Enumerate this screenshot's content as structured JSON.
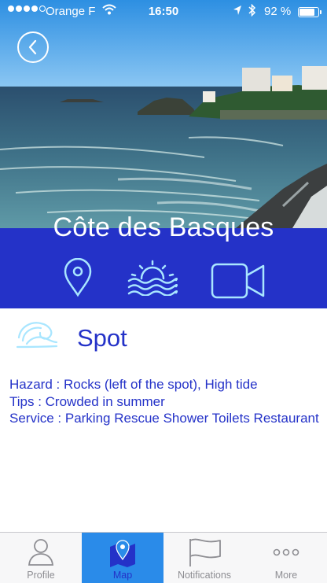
{
  "status_bar": {
    "carrier": "Orange F",
    "time": "16:50",
    "battery": "92 %",
    "battery_level": 0.92
  },
  "header": {
    "title": "Côte des Basques"
  },
  "actions": [
    {
      "icon": "location-pin-icon"
    },
    {
      "icon": "sunset-icon"
    },
    {
      "icon": "video-camera-icon"
    }
  ],
  "section": {
    "icon": "wave-icon",
    "title": "Spot"
  },
  "info": {
    "hazard": "Hazard : Rocks (left of the spot), High tide",
    "tips": "Tips : Crowded in summer",
    "service": "Service : Parking Rescue Shower Toilets Restaurant"
  },
  "tab_bar": {
    "active": "map",
    "tabs": [
      {
        "id": "profile",
        "label": "Profile",
        "icon": "person-icon"
      },
      {
        "id": "map",
        "label": "Map",
        "icon": "map-pin-icon"
      },
      {
        "id": "notifications",
        "label": "Notifications",
        "icon": "flag-icon"
      },
      {
        "id": "more",
        "label": "More",
        "icon": "ellipsis-icon"
      }
    ]
  },
  "colors": {
    "brand_blue": "#2432c8",
    "tab_active": "#2a8be9",
    "icon_light": "#a9e6ff"
  }
}
